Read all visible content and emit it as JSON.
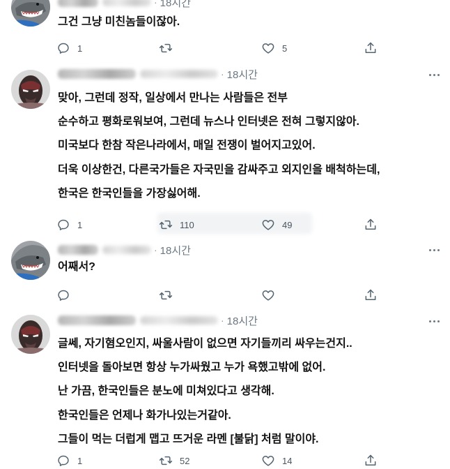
{
  "tweets": [
    {
      "time": "18시간",
      "lines": [
        "그건 그냥 미친놈들이잖아."
      ],
      "replies": "1",
      "retweets": "",
      "likes": "5"
    },
    {
      "time": "18시간",
      "lines": [
        "맞아, 그런데 정작, 일상에서 만나는 사람들은 전부",
        "순수하고 평화로워보여, 그런데 뉴스나 인터넷은 전혀 그렇지않아.",
        "미국보다 한참 작은나라에서, 매일 전쟁이 벌어지고있어.",
        "더욱 이상한건, 다른국가들은 자국민을 감싸주고 외지인을 배척하는데,",
        "한국은 한국인들을 가장싫어해."
      ],
      "replies": "1",
      "retweets": "110",
      "likes": "49"
    },
    {
      "time": "18시간",
      "lines": [
        "어째서?"
      ],
      "replies": "",
      "retweets": "",
      "likes": ""
    },
    {
      "time": "18시간",
      "lines": [
        "글쎄, 자기혐오인지, 싸울사람이 없으면 자기들끼리 싸우는건지..",
        "인터넷을 돌아보면 항상 누가싸웠고 누가 욕했고밖에 없어.",
        "난 가끔, 한국인들은 분노에 미쳐있다고 생각해.",
        "한국인들은 언제나 화가나있는거같아.",
        "그들이 먹는 더럽게 맵고 뜨거운 라멘 [불닭] 처럼 말이야."
      ],
      "replies": "1",
      "retweets": "52",
      "likes": "14"
    }
  ],
  "icons": {
    "reply": "reply-icon",
    "retweet": "retweet-icon",
    "like": "heart-icon",
    "share": "share-icon",
    "more": "more-icon"
  },
  "colors": {
    "icon": "#536471",
    "text": "#0f1419",
    "meta": "#6b7883"
  }
}
